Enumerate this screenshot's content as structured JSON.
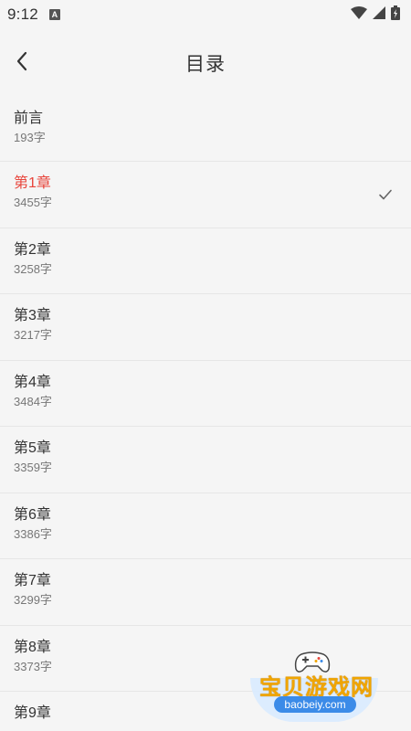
{
  "status_bar": {
    "time": "9:12",
    "notification_icon_letter": "A",
    "icons": [
      "wifi-icon",
      "signal-icon",
      "battery-icon"
    ]
  },
  "header": {
    "title": "目录",
    "back_icon": "chevron-left-icon"
  },
  "chapters": [
    {
      "title": "前言",
      "count": "193字",
      "active": false
    },
    {
      "title": "第1章",
      "count": "3455字",
      "active": true
    },
    {
      "title": "第2章",
      "count": "3258字",
      "active": false
    },
    {
      "title": "第3章",
      "count": "3217字",
      "active": false
    },
    {
      "title": "第4章",
      "count": "3484字",
      "active": false
    },
    {
      "title": "第5章",
      "count": "3359字",
      "active": false
    },
    {
      "title": "第6章",
      "count": "3386字",
      "active": false
    },
    {
      "title": "第7章",
      "count": "3299字",
      "active": false
    },
    {
      "title": "第8章",
      "count": "3373字",
      "active": false
    },
    {
      "title": "第9章",
      "count": "",
      "active": false
    }
  ],
  "colors": {
    "active_title": "#e8453c",
    "text": "#333333",
    "subtext": "#777777",
    "background": "#f5f5f5",
    "divider": "#e6e6e6"
  },
  "watermark": {
    "name": "宝贝游戏网",
    "url": "baobeiy.com"
  }
}
